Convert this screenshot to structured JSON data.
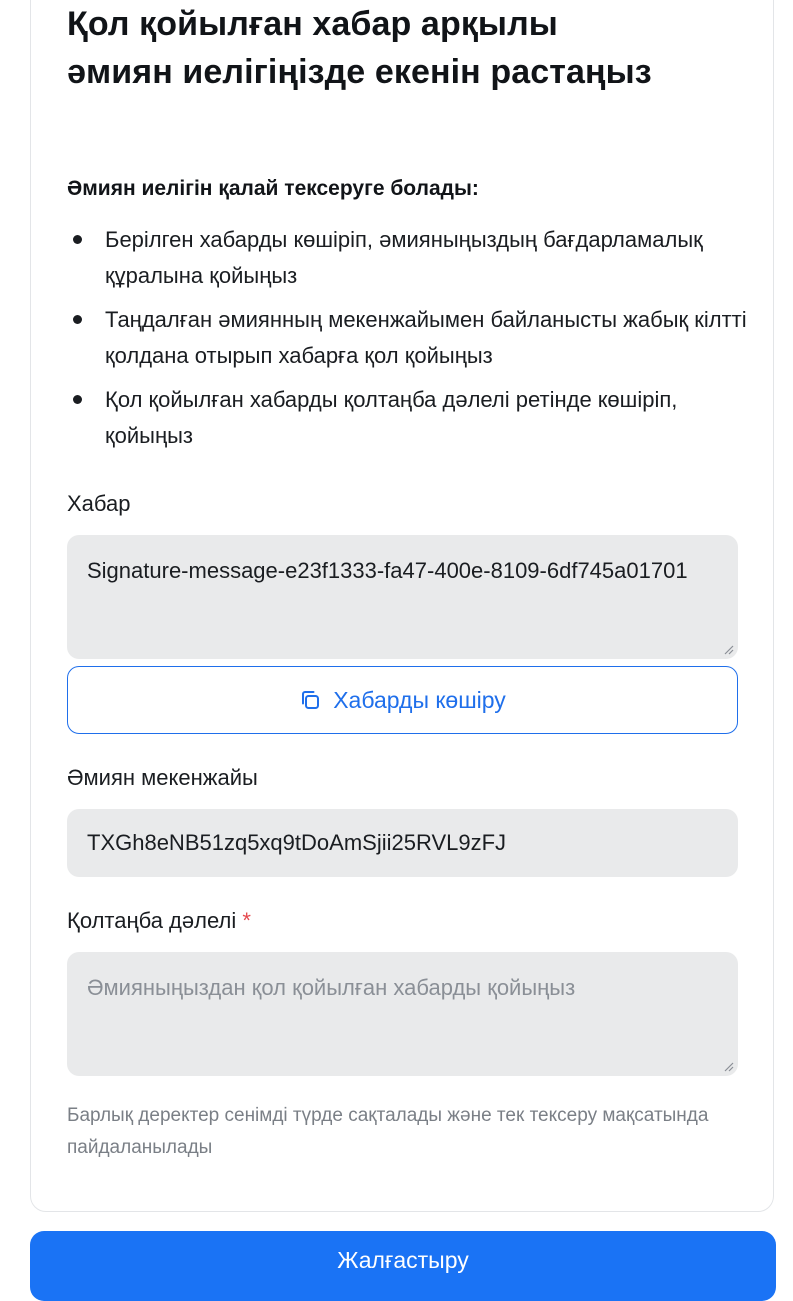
{
  "title": {
    "line1": "Қол қойылған хабар арқылы",
    "line2": "әмиян иелігіңізде екенін растаңыз"
  },
  "howto": {
    "heading": "Әмиян иелігін қалай тексеруге болады:",
    "steps": [
      "Берілген хабарды көшіріп, әмияныңыздың бағдарламалық құралына қойыңыз",
      "Таңдалған әмиянның мекенжайымен байланысты жабық кілтті қолдана отырып хабарға қол қойыңыз",
      "Қол қойылған хабарды қолтаңба дәлелі ретінде көшіріп, қойыңыз"
    ]
  },
  "message": {
    "label": "Хабар",
    "value": "Signature-message-e23f1333-fa47-400e-8109-6df745a01701",
    "copy_button": "Хабарды көшіру"
  },
  "wallet": {
    "label": "Әмиян мекенжайы",
    "address": "TXGh8eNB51zq5xq9tDoAmSjii25RVL9zFJ"
  },
  "signature": {
    "label": "Қолтаңба дәлелі",
    "required_mark": "*",
    "placeholder": "Әмияныңыздан қол қойылған хабарды қойыңыз"
  },
  "note": "Барлық деректер сенімді түрде сақталады және тек тексеру мақсатында пайдаланылады",
  "continue_button": "Жалғастыру",
  "colors": {
    "accent": "#1a73f5",
    "required": "#e5484d",
    "field_bg": "#e9eaeb"
  }
}
